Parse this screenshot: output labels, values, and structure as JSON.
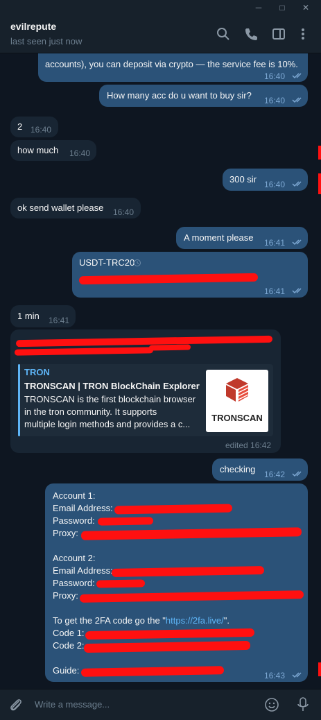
{
  "window": {
    "minimize": "─",
    "maximize": "□",
    "close": "✕"
  },
  "header": {
    "name": "evilrepute",
    "status": "last seen just now"
  },
  "messages": {
    "m0": {
      "text": "accounts), you can deposit via crypto — the service fee is 10%.",
      "time": "16:40"
    },
    "m1": {
      "text": "How many acc do u want to buy sir?",
      "time": "16:40"
    },
    "m2": {
      "text": "2",
      "time": "16:40"
    },
    "m3": {
      "text": "how much",
      "time": "16:40"
    },
    "m4": {
      "text": "300 sir",
      "time": "16:40"
    },
    "m5": {
      "text": "ok send wallet please",
      "time": "16:40"
    },
    "m6": {
      "text": "A moment please",
      "time": "16:41"
    },
    "m7": {
      "text": "USDT-TRC20",
      "time": "16:41"
    },
    "m8": {
      "text": "1 min",
      "time": "16:41"
    },
    "m9": {
      "time": "edited 16:42",
      "preview": {
        "site": "TRON",
        "title": "TRONSCAN | TRON BlockChain Explorer",
        "desc1": "TRONSCAN is the first blockchain browser",
        "desc2": "in the tron community. It supports",
        "desc3": "multiple login methods and provides a c...",
        "logo_text": "TRONSCAN"
      }
    },
    "m10": {
      "text": "checking",
      "time": "16:42"
    },
    "m11": {
      "acc1": "Account 1:",
      "email1": "Email Address:",
      "pass1": "Password:",
      "proxy1": "Proxy:",
      "acc2": "Account 2:",
      "email2": "Email Address:",
      "pass2": "Password:",
      "proxy2": "Proxy:",
      "twofa_prefix": "To get the 2FA code go the \"",
      "twofa_link": "https://2fa.live/",
      "twofa_suffix": "\".",
      "code1": "Code 1:",
      "code2": "Code 2:",
      "guide": "Guide:",
      "time": "16:43"
    }
  },
  "composer": {
    "placeholder": "Write a message..."
  },
  "colors": {
    "out_bubble": "#2b5278",
    "in_bubble": "#182533",
    "background": "#0e1621",
    "accent": "#5eb5f7",
    "redaction": "#ff1010"
  }
}
